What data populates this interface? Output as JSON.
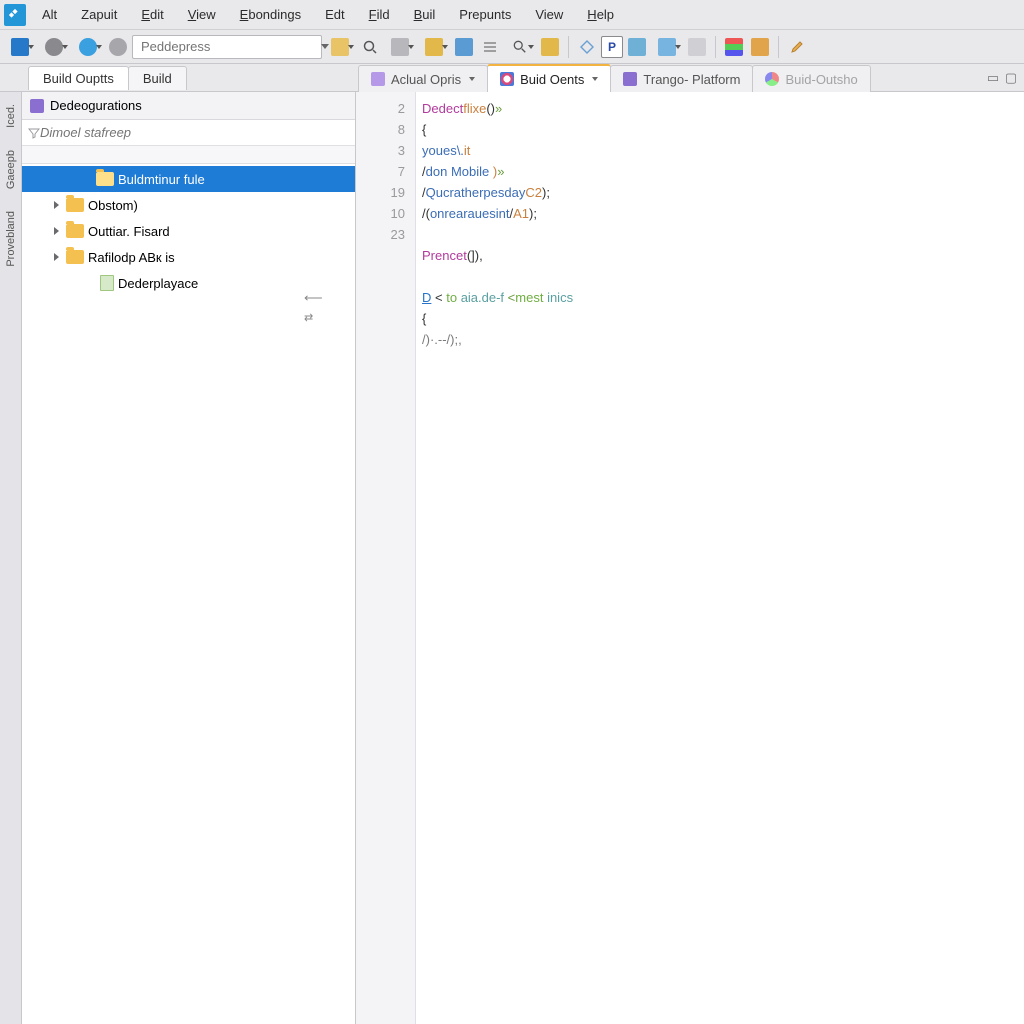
{
  "menu": {
    "items": [
      "Alt",
      "Zapuit",
      "Edit",
      "View",
      "Ebondings",
      "Edt",
      "Fild",
      "Buil",
      "Prepunts",
      "View",
      "Help"
    ]
  },
  "toolbar": {
    "search_placeholder": "Peddepress"
  },
  "panel_tabs": {
    "t0": "Build Ouptts",
    "t1": "Build"
  },
  "sidebar": {
    "header": "Dedeogurations",
    "filter_placeholder": "Dimoel stafreep",
    "tree": [
      {
        "label": "Buldmtinur fule",
        "selected": true,
        "indent": 2,
        "icon": "folder",
        "expandable": false
      },
      {
        "label": "Obstom)",
        "selected": false,
        "indent": 1,
        "icon": "folder",
        "expandable": true
      },
      {
        "label": "Outtiar. Fisard",
        "selected": false,
        "indent": 1,
        "icon": "folder",
        "expandable": true
      },
      {
        "label": "Rafilodp ABк is",
        "selected": false,
        "indent": 1,
        "icon": "folder",
        "expandable": true
      },
      {
        "label": "Dederplayace",
        "selected": false,
        "indent": 3,
        "icon": "file",
        "expandable": false
      }
    ]
  },
  "editor_tabs": {
    "t0": "Aclual Opris",
    "t1": "Buid Oents",
    "t2": "Trango- Platform",
    "t3": "Buid-Outsho"
  },
  "editor": {
    "line_numbers": [
      "2",
      "8",
      "3",
      "7",
      "19",
      "10",
      "23"
    ],
    "code": {
      "l1": {
        "a": "Dedect",
        "b": "flixe",
        "c": "()",
        "d": "»"
      },
      "l2": {
        "a": "{"
      },
      "l3": {
        "a": "youes\\.",
        "b": "it"
      },
      "l4": {
        "a": "/",
        "b": "don ",
        "c": "Mobile ",
        "d": ")",
        "e": "»"
      },
      "l5": {
        "a": "/",
        "b": "Qucratherpesday",
        "c": "C2",
        "d": ");"
      },
      "l6": {
        "a": "/(",
        "b": "onrearauesint",
        "c": "/",
        "d": "A1",
        "e": ");"
      },
      "l7": {
        "a": ""
      },
      "l8": {
        "a": "Prencet",
        "b": "(]),"
      },
      "l9": {
        "a": ""
      },
      "l10": {
        "a": "D",
        "b": " < ",
        "c": "to ",
        "d": "aia.de-f ",
        "e": "<",
        "f": "mest ",
        "g": "inics"
      },
      "l11": {
        "a": "{"
      },
      "l12": {
        "a": "/)·.--/);,"
      }
    }
  },
  "leftbar": {
    "l0": "Iced.",
    "l1": "Gaeepb",
    "l2": "Provebland"
  },
  "colors": {
    "selection": "#1e7bd6",
    "accent_tab": "#f2b340"
  }
}
